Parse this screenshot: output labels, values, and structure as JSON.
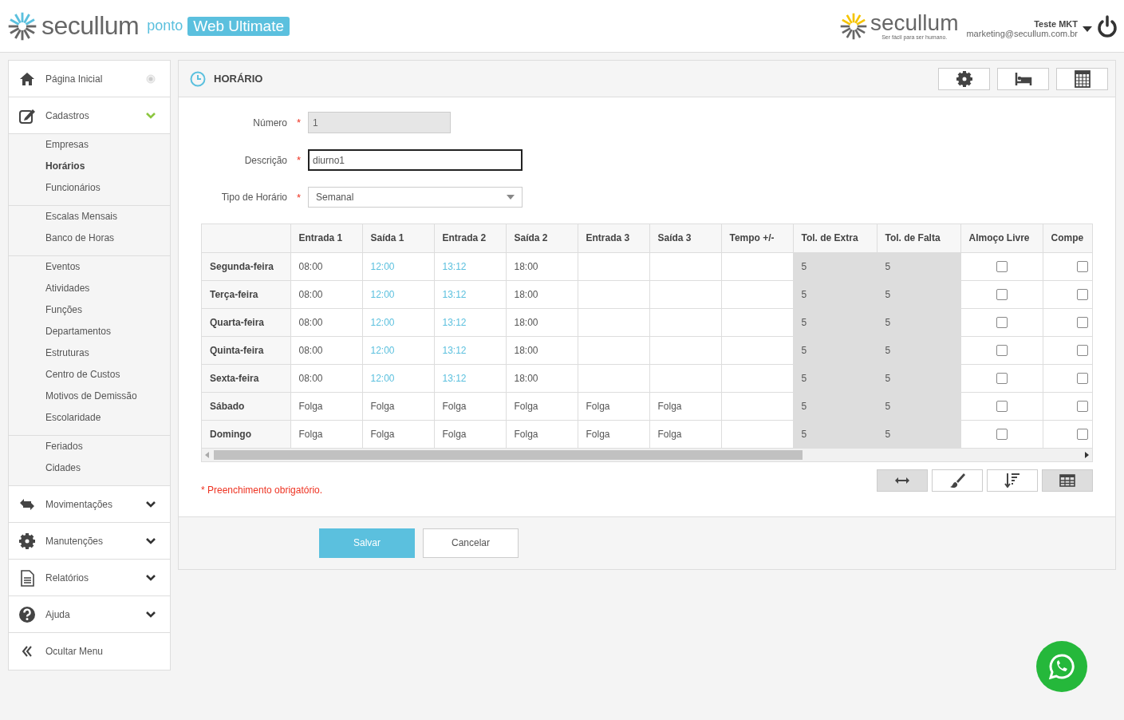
{
  "header": {
    "brand": "secullum",
    "product": "ponto",
    "edition": "Web Ultimate",
    "partner_brand": "secullum",
    "partner_tagline": "Ser fácil para ser humano.",
    "user_name": "Teste MKT",
    "user_email": "marketing@secullum.com.br"
  },
  "sidebar": {
    "items": [
      {
        "kind": "link",
        "label": "Página Inicial"
      },
      {
        "kind": "section",
        "label": "Cadastros",
        "expanded": true,
        "groups": [
          [
            {
              "label": "Empresas",
              "selected": false
            },
            {
              "label": "Horários",
              "selected": true
            },
            {
              "label": "Funcionários",
              "selected": false
            }
          ],
          [
            {
              "label": "Escalas Mensais",
              "selected": false
            },
            {
              "label": "Banco de Horas",
              "selected": false
            }
          ],
          [
            {
              "label": "Eventos",
              "selected": false
            },
            {
              "label": "Atividades",
              "selected": false
            },
            {
              "label": "Funções",
              "selected": false
            },
            {
              "label": "Departamentos",
              "selected": false
            },
            {
              "label": "Estruturas",
              "selected": false
            },
            {
              "label": "Centro de Custos",
              "selected": false
            },
            {
              "label": "Motivos de Demissão",
              "selected": false
            },
            {
              "label": "Escolaridade",
              "selected": false
            }
          ],
          [
            {
              "label": "Feriados",
              "selected": false
            },
            {
              "label": "Cidades",
              "selected": false
            }
          ]
        ]
      },
      {
        "kind": "section",
        "label": "Movimentações",
        "expanded": false
      },
      {
        "kind": "section",
        "label": "Manutenções",
        "expanded": false
      },
      {
        "kind": "section",
        "label": "Relatórios",
        "expanded": false
      },
      {
        "kind": "section",
        "label": "Ajuda",
        "expanded": false
      },
      {
        "kind": "collapse",
        "label": "Ocultar Menu"
      }
    ]
  },
  "panel": {
    "title": "HORÁRIO",
    "fields": [
      {
        "kind": "text",
        "label": "Número",
        "required_mark": "*",
        "value": "1",
        "disabled": true,
        "focused": false
      },
      {
        "kind": "text",
        "label": "Descrição",
        "required_mark": "*",
        "value": "diurno1",
        "disabled": false,
        "focused": true
      },
      {
        "kind": "select",
        "label": "Tipo de Horário",
        "required_mark": "*",
        "value": "Semanal"
      }
    ],
    "table": {
      "columns": [
        {
          "kind": "day"
        },
        {
          "label": "Entrada 1",
          "kind": "time"
        },
        {
          "label": "Saída 1",
          "kind": "time"
        },
        {
          "label": "Entrada 2",
          "kind": "time"
        },
        {
          "label": "Saída 2",
          "kind": "time"
        },
        {
          "label": "Entrada 3",
          "kind": "time"
        },
        {
          "label": "Saída 3",
          "kind": "time"
        },
        {
          "label": "Tempo +/-",
          "kind": "time"
        },
        {
          "label": "Tol. de Extra",
          "kind": "number",
          "readonly": true
        },
        {
          "label": "Tol. de Falta",
          "kind": "number",
          "readonly": true
        },
        {
          "label": "Almoço Livre",
          "kind": "check"
        },
        {
          "label": "Compe",
          "kind": "check"
        }
      ],
      "rows": [
        {
          "cells": [
            {
              "text": "Segunda-feira"
            },
            {
              "text": "08:00",
              "highlighted": false
            },
            {
              "text": "12:00",
              "highlighted": true
            },
            {
              "text": "13:12",
              "highlighted": true
            },
            {
              "text": "18:00",
              "highlighted": false
            },
            {
              "text": null
            },
            {
              "text": null
            },
            {
              "text": null
            },
            {
              "text": "5"
            },
            {
              "text": "5"
            },
            {
              "checked": false
            },
            {
              "checked": false
            }
          ]
        },
        {
          "cells": [
            {
              "text": "Terça-feira"
            },
            {
              "text": "08:00",
              "highlighted": false
            },
            {
              "text": "12:00",
              "highlighted": true
            },
            {
              "text": "13:12",
              "highlighted": true
            },
            {
              "text": "18:00",
              "highlighted": false
            },
            {
              "text": null
            },
            {
              "text": null
            },
            {
              "text": null
            },
            {
              "text": "5"
            },
            {
              "text": "5"
            },
            {
              "checked": false
            },
            {
              "checked": false
            }
          ]
        },
        {
          "cells": [
            {
              "text": "Quarta-feira"
            },
            {
              "text": "08:00",
              "highlighted": false
            },
            {
              "text": "12:00",
              "highlighted": true
            },
            {
              "text": "13:12",
              "highlighted": true
            },
            {
              "text": "18:00",
              "highlighted": false
            },
            {
              "text": null
            },
            {
              "text": null
            },
            {
              "text": null
            },
            {
              "text": "5"
            },
            {
              "text": "5"
            },
            {
              "checked": false
            },
            {
              "checked": false
            }
          ]
        },
        {
          "cells": [
            {
              "text": "Quinta-feira"
            },
            {
              "text": "08:00",
              "highlighted": false
            },
            {
              "text": "12:00",
              "highlighted": true
            },
            {
              "text": "13:12",
              "highlighted": true
            },
            {
              "text": "18:00",
              "highlighted": false
            },
            {
              "text": null
            },
            {
              "text": null
            },
            {
              "text": null
            },
            {
              "text": "5"
            },
            {
              "text": "5"
            },
            {
              "checked": false
            },
            {
              "checked": false
            }
          ]
        },
        {
          "cells": [
            {
              "text": "Sexta-feira"
            },
            {
              "text": "08:00",
              "highlighted": false
            },
            {
              "text": "12:00",
              "highlighted": true
            },
            {
              "text": "13:12",
              "highlighted": true
            },
            {
              "text": "18:00",
              "highlighted": false
            },
            {
              "text": null
            },
            {
              "text": null
            },
            {
              "text": null
            },
            {
              "text": "5"
            },
            {
              "text": "5"
            },
            {
              "checked": false
            },
            {
              "checked": false
            }
          ]
        },
        {
          "cells": [
            {
              "text": "Sábado"
            },
            {
              "text": "Folga",
              "highlighted": false
            },
            {
              "text": "Folga",
              "highlighted": false
            },
            {
              "text": "Folga",
              "highlighted": false
            },
            {
              "text": "Folga",
              "highlighted": false
            },
            {
              "text": "Folga",
              "highlighted": false
            },
            {
              "text": "Folga",
              "highlighted": false
            },
            {
              "text": null
            },
            {
              "text": "5"
            },
            {
              "text": "5"
            },
            {
              "checked": false
            },
            {
              "checked": false
            }
          ]
        },
        {
          "cells": [
            {
              "text": "Domingo"
            },
            {
              "text": "Folga",
              "highlighted": false
            },
            {
              "text": "Folga",
              "highlighted": false
            },
            {
              "text": "Folga",
              "highlighted": false
            },
            {
              "text": "Folga",
              "highlighted": false
            },
            {
              "text": "Folga",
              "highlighted": false
            },
            {
              "text": "Folga",
              "highlighted": false
            },
            {
              "text": null
            },
            {
              "text": "5"
            },
            {
              "text": "5"
            },
            {
              "checked": false
            },
            {
              "checked": false
            }
          ]
        }
      ]
    },
    "table_tools": [
      {
        "active": true
      },
      {
        "active": false
      },
      {
        "active": false
      },
      {
        "active": true
      }
    ],
    "required_note": "* Preenchimento obrigatório.",
    "buttons": [
      {
        "kind": "primary",
        "label": "Salvar"
      },
      {
        "kind": "secondary",
        "label": "Cancelar"
      }
    ]
  }
}
